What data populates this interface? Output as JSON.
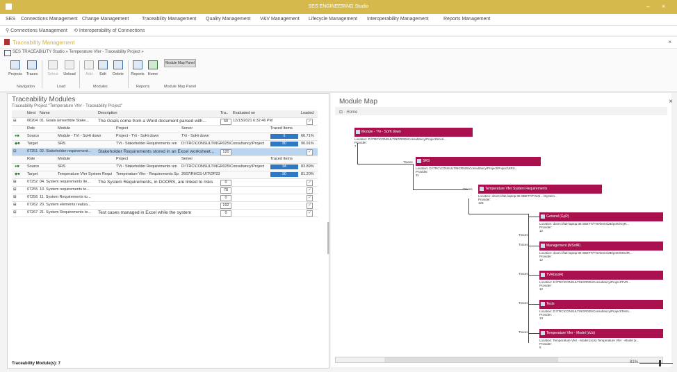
{
  "window": {
    "title": "SES ENGINEERING Studio",
    "accent": "#d6b94c"
  },
  "menu": [
    "SES",
    "Connections Management",
    "Change Management",
    "Traceability Management",
    "Quality Management",
    "V&V Management",
    "Lifecycle Management",
    "Interoperability Management",
    "Reports Management"
  ],
  "crumbs": [
    "Connections Management",
    "Interoperability of Connections"
  ],
  "module_header": "Traceability Management",
  "address": "SES TRACEABILITY Studio  »  Temperature Vfer - Traceability Project  »",
  "ribbon": {
    "buttons": [
      "Projects",
      "Traces",
      "Select",
      "Unload",
      "Add",
      "Edit",
      "Delete",
      "Reports",
      "Home"
    ],
    "map_panel": "Module Map Panel",
    "groups": [
      "Navigation",
      "Load",
      "Modules",
      "Reports",
      "Module Map Panel"
    ]
  },
  "left": {
    "title": "Traceability Modules",
    "subtitle": "Traceability Project \"Temperature Vfer - Traceability Project\"",
    "columns": [
      "Ident",
      "Name",
      "Description",
      "Tra..",
      "Evaluated on",
      "Loaded"
    ],
    "subcolumns": [
      "Role",
      "Module",
      "Project",
      "Server",
      "Traced Items"
    ],
    "status": "Traceability Module(s): 7",
    "rows": [
      {
        "id": "06204",
        "name": "01. Goals (ensemble Stake...",
        "desc": "The Goals come from a Word document parsed with...",
        "tra": "60",
        "eval": "12/13/2021 6:32:46 PM",
        "sub": [
          {
            "role": "Source",
            "module": "Module - TVi - SoHi down",
            "project": "Project - TVi - SoHi down",
            "server": "TVi - SoHi down",
            "traced": "6",
            "pct": "66.71%",
            "bar": 0.67
          },
          {
            "role": "Target",
            "module": "SRS",
            "project": "TVi - Stakeholder Requirements ren",
            "server": "D:\\TRC\\CONSULT\\NGR025\\Consultancy\\Project",
            "traced": "80",
            "pct": "90.91%",
            "bar": 0.91
          }
        ]
      },
      {
        "id": "07251",
        "name": "02. Stakeholder requirement...",
        "desc": "Stakeholder Requirements stored in an Excel worksheet...",
        "tra": "120",
        "eval": "",
        "selected": true,
        "sub": [
          {
            "role": "Source",
            "module": "SRS",
            "project": "TVi - Stakeholder Requirements ren",
            "server": "D:\\TRC\\CONSULT\\NGR025\\Consultancy\\Project",
            "traced": "94",
            "pct": "83.89%",
            "bar": 0.84
          },
          {
            "role": "Target",
            "module": "Temperature Vfer System Requi",
            "project": "Temperature Vfer - Requirements Spe",
            "server": "2667\\RHCS-UIT\\DP23",
            "traced": "50",
            "pct": "81.20%",
            "bar": 0.81
          }
        ]
      },
      {
        "id": "07252",
        "name": "04. System requirements ite...",
        "desc": "The System Requirements, in DOORS, are linked to risks",
        "tra": "0",
        "eval": ""
      },
      {
        "id": "07255",
        "name": "10. System requirements to...",
        "desc": "",
        "tra": "78",
        "eval": ""
      },
      {
        "id": "07256",
        "name": "11. System Requirements to...",
        "desc": "",
        "tra": "0",
        "eval": ""
      },
      {
        "id": "07262",
        "name": "20. System elements realiza...",
        "desc": "",
        "tra": "192",
        "eval": ""
      },
      {
        "id": "07267",
        "name": "21. System Requirements te...",
        "desc": "Test cases managed in Excel while the system",
        "tra": "0",
        "eval": ""
      }
    ]
  },
  "right": {
    "title": "Module Map",
    "home": "Home",
    "zoom": "81%",
    "nodes": [
      {
        "label": "Module - TVi - SoHi down",
        "detail": "Location: D:\\TRC\\CONSULT\\NGR025\\Consultancy\\Project\\SoHi...",
        "prov": "Provider:",
        "val": "7"
      },
      {
        "label": "SRS",
        "detail": "Location: D:\\TRC\\CONSULT\\NGR025\\Consultancy\\Project\\Project\\SRS...",
        "prov": "Provider:",
        "val": "11"
      },
      {
        "label": "Temperature Vfer System Requirements",
        "detail": "Location: doors://lab-laptop:36 SBETT/TVerti…\\System...",
        "prov": "Provider:",
        "val": "123"
      },
      {
        "label": "General (GyR)",
        "detail": "Location: doors://lab-laptop:36 SBETT/TVeritems/ZE/pmtr/GyR...",
        "prov": "Provider:",
        "val": "12"
      },
      {
        "label": "Management (MSofR)",
        "detail": "Location: doors://lab-laptop:36 SBETT/TVeritems/ZE/pmtr/MSofR...",
        "prov": "Provider:",
        "val": "12"
      },
      {
        "label": "TVR(sysR)",
        "detail": "Location: D:\\TRC\\CONSULT\\NGR025\\Consultancy\\Project\\TVR...",
        "prov": "Provider:",
        "val": "12"
      },
      {
        "label": "Tests",
        "detail": "Location: D:\\TRC\\CONSULT\\NGR025\\Consultancy\\Project\\Tests...",
        "prov": "Provider:",
        "val": "13"
      },
      {
        "label": "Temperature Vfer - Model (xUs)",
        "detail": "Location: Temperature Vfer - Model (xUs) Temperature Vfer - Model (x...",
        "prov": "Provider:",
        "val": "6"
      }
    ],
    "edges": [
      "Traces",
      "Traces",
      "Traces",
      "Traces",
      "Traces",
      "Traces",
      "Traces"
    ]
  }
}
